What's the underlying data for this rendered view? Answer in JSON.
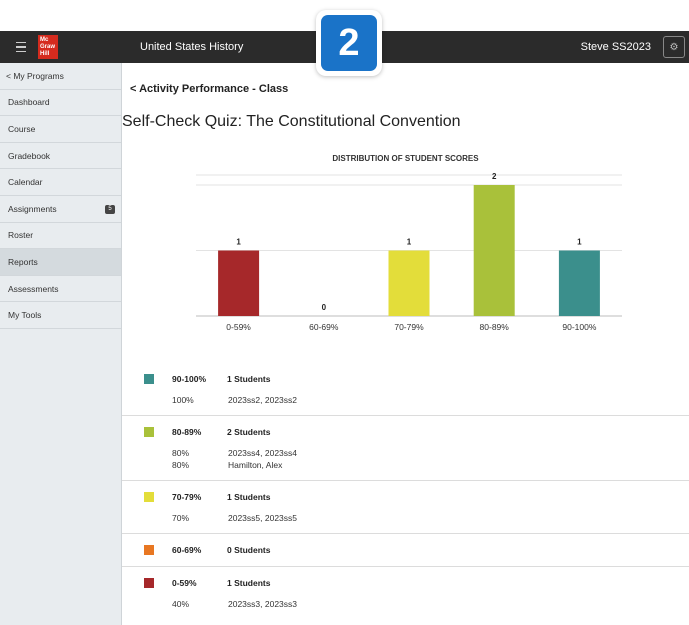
{
  "header": {
    "app_title": "United States History",
    "user_name": "Steve SS2023",
    "logo_text": "Mc Graw Hill"
  },
  "overlay": {
    "step_number": "2"
  },
  "sidebar": {
    "back_label": "< My Programs",
    "items": [
      {
        "label": "Dashboard"
      },
      {
        "label": "Course"
      },
      {
        "label": "Gradebook"
      },
      {
        "label": "Calendar"
      },
      {
        "label": "Assignments",
        "badge": "5"
      },
      {
        "label": "Roster"
      },
      {
        "label": "Reports",
        "active": true
      },
      {
        "label": "Assessments"
      },
      {
        "label": "My Tools"
      }
    ]
  },
  "main": {
    "back_title": "< Activity Performance - Class",
    "page_title": "Self-Check Quiz: The Constitutional Convention"
  },
  "chart_data": {
    "type": "bar",
    "title": "DISTRIBUTION OF STUDENT SCORES",
    "categories": [
      "0-59%",
      "60-69%",
      "70-79%",
      "80-89%",
      "90-100%"
    ],
    "values": [
      1,
      0,
      1,
      2,
      1
    ],
    "colors": [
      "#a6282a",
      "#e87722",
      "#e3dd3a",
      "#a9c13a",
      "#3b8f8c"
    ],
    "ylim": [
      0,
      2
    ],
    "grid": true
  },
  "results": [
    {
      "range": "90-100%",
      "count": "1 Students",
      "color": "#3b8f8c",
      "rows": [
        {
          "pct": "100%",
          "names": "2023ss2, 2023ss2"
        }
      ]
    },
    {
      "range": "80-89%",
      "count": "2 Students",
      "color": "#a9c13a",
      "rows": [
        {
          "pct": "80%",
          "names": "2023ss4, 2023ss4"
        },
        {
          "pct": "80%",
          "names": "Hamilton, Alex"
        }
      ]
    },
    {
      "range": "70-79%",
      "count": "1 Students",
      "color": "#e3dd3a",
      "rows": [
        {
          "pct": "70%",
          "names": "2023ss5, 2023ss5"
        }
      ]
    },
    {
      "range": "60-69%",
      "count": "0 Students",
      "color": "#e87722",
      "rows": []
    },
    {
      "range": "0-59%",
      "count": "1 Students",
      "color": "#a6282a",
      "rows": [
        {
          "pct": "40%",
          "names": "2023ss3, 2023ss3"
        }
      ]
    }
  ]
}
